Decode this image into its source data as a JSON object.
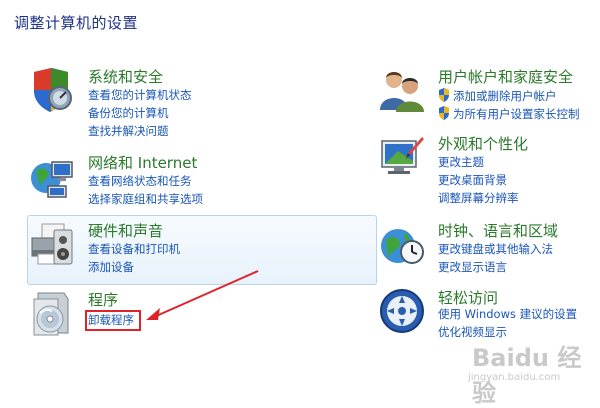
{
  "page_title": "调整计算机的设置",
  "categories": {
    "system": {
      "title": "系统和安全",
      "links": [
        "查看您的计算机状态",
        "备份您的计算机",
        "查找并解决问题"
      ],
      "icon": "shield-icon"
    },
    "network": {
      "title": "网络和 Internet",
      "links": [
        "查看网络状态和任务",
        "选择家庭组和共享选项"
      ],
      "icon": "network-icon"
    },
    "hardware": {
      "title": "硬件和声音",
      "links": [
        "查看设备和打印机",
        "添加设备"
      ],
      "icon": "printer-icon"
    },
    "programs": {
      "title": "程序",
      "links": [
        "卸载程序"
      ],
      "icon": "programs-icon"
    },
    "users": {
      "title": "用户帐户和家庭安全",
      "links": [
        "添加或删除用户帐户",
        "为所有用户设置家长控制"
      ],
      "icon": "users-icon"
    },
    "appearance": {
      "title": "外观和个性化",
      "links": [
        "更改主题",
        "更改桌面背景",
        "调整屏幕分辨率"
      ],
      "icon": "display-icon"
    },
    "clock": {
      "title": "时钟、语言和区域",
      "links": [
        "更改键盘或其他输入法",
        "更改显示语言"
      ],
      "icon": "globe-clock-icon"
    },
    "ease": {
      "title": "轻松访问",
      "links": [
        "使用 Windows 建议的设置",
        "优化视频显示"
      ],
      "icon": "ease-of-access-icon"
    }
  },
  "colors": {
    "title": "#1e3287",
    "category": "#2a7a2a",
    "link": "#1a56b8",
    "highlight": "#e0222a"
  },
  "watermark": {
    "main": "Baidu 经验",
    "sub": "jingyan.baidu.com"
  }
}
